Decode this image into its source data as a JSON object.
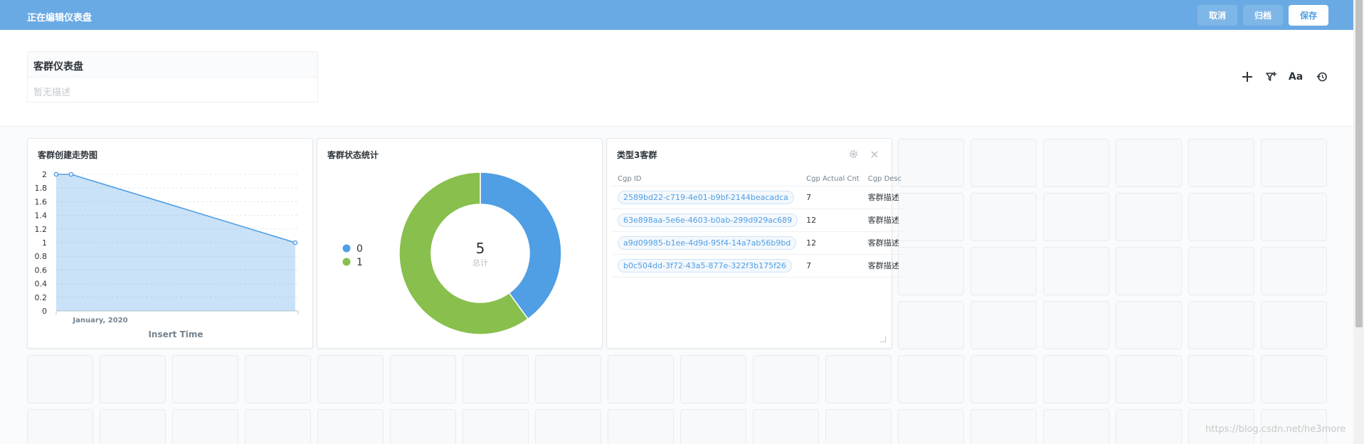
{
  "editbar": {
    "title": "正在编辑仪表盘",
    "cancel_label": "取消",
    "archive_label": "归档",
    "save_label": "保存"
  },
  "dashboard": {
    "name": "客群仪表盘",
    "description": "暂无描述"
  },
  "header_icons": [
    "add-card-icon",
    "filter-add-icon",
    "text-box-icon",
    "history-icon"
  ],
  "cards": {
    "trend": {
      "title": "客群创建走势图",
      "chart_data": {
        "type": "area",
        "x": [
          "2019-12-30",
          "2020-01-01",
          "2020-01-31"
        ],
        "values": [
          2,
          2,
          1
        ],
        "xlabel": "Insert Time",
        "ylabel": "",
        "x_tick_labels": [
          "January, 2020"
        ],
        "y_ticks": [
          0,
          0.2,
          0.4,
          0.6,
          0.8,
          1,
          1.2,
          1.4,
          1.6,
          1.8,
          2
        ],
        "ylim": [
          0,
          2
        ],
        "grid": true,
        "color": "#509ee3"
      }
    },
    "status": {
      "title": "客群状态统计",
      "chart_data": {
        "type": "pie",
        "donut": true,
        "slices": [
          {
            "label": "0",
            "value": 2,
            "color": "#509ee3"
          },
          {
            "label": "1",
            "value": 3,
            "color": "#88bf4d"
          }
        ],
        "center_value": "5",
        "center_label": "总计",
        "legend_position": "left"
      }
    },
    "table": {
      "title": "类型3客群",
      "columns": [
        "Cgp ID",
        "Cgp Actual Cnt",
        "Cgp Desc"
      ],
      "rows": [
        {
          "id": "2589bd22-c719-4e01-b9bf-2144beacadca",
          "cnt": "7",
          "desc": "客群描述"
        },
        {
          "id": "63e898aa-5e6e-4603-b0ab-299d929ac689",
          "cnt": "12",
          "desc": "客群描述"
        },
        {
          "id": "a9d09985-b1ee-4d9d-95f4-14a7ab56b9bd",
          "cnt": "12",
          "desc": "客群描述"
        },
        {
          "id": "b0c504dd-3f72-43a5-877e-322f3b175f26",
          "cnt": "7",
          "desc": "客群描述"
        }
      ]
    }
  },
  "watermark": "https://blog.csdn.net/he3more"
}
